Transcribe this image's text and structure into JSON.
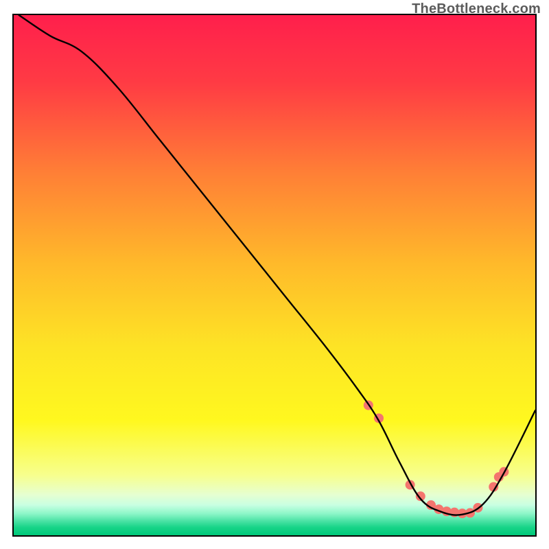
{
  "watermark": "TheBottleneck.com",
  "chart_data": {
    "type": "line",
    "title": "",
    "xlabel": "",
    "ylabel": "",
    "xlim": [
      0,
      100
    ],
    "ylim": [
      0,
      100
    ],
    "grid": false,
    "legend": false,
    "series": [
      {
        "name": "curve",
        "color": "#000000",
        "x": [
          1,
          7,
          13,
          20,
          28,
          36,
          44,
          52,
          60,
          66,
          70,
          74,
          78,
          82,
          86,
          90,
          94,
          100
        ],
        "y": [
          100,
          96,
          93,
          86,
          76,
          66,
          56,
          46,
          36,
          28,
          22,
          14,
          7,
          4.5,
          4,
          6,
          12,
          24
        ]
      }
    ],
    "markers": {
      "name": "highlight-points",
      "color": "#f4756e",
      "radius_px": 7,
      "x": [
        68,
        70,
        76,
        78,
        80,
        81.5,
        83,
        84.5,
        86,
        87.5,
        89,
        92,
        93,
        94
      ],
      "y": [
        25,
        22.5,
        9.7,
        7.5,
        5.8,
        5.0,
        4.6,
        4.4,
        4.2,
        4.3,
        5.3,
        9.3,
        11.2,
        12.2
      ]
    },
    "background_gradient": {
      "stops": [
        {
          "offset": 0.0,
          "color": "#ff1f4c"
        },
        {
          "offset": 0.13,
          "color": "#ff3b44"
        },
        {
          "offset": 0.3,
          "color": "#ff7e36"
        },
        {
          "offset": 0.48,
          "color": "#ffba2a"
        },
        {
          "offset": 0.64,
          "color": "#fde425"
        },
        {
          "offset": 0.78,
          "color": "#fff81f"
        },
        {
          "offset": 0.885,
          "color": "#f7ff8e"
        },
        {
          "offset": 0.922,
          "color": "#e6ffd1"
        },
        {
          "offset": 0.942,
          "color": "#c8ffe2"
        },
        {
          "offset": 0.958,
          "color": "#8ef7c9"
        },
        {
          "offset": 0.972,
          "color": "#4de3a6"
        },
        {
          "offset": 0.985,
          "color": "#17d487"
        },
        {
          "offset": 1.0,
          "color": "#00c87a"
        }
      ]
    }
  }
}
